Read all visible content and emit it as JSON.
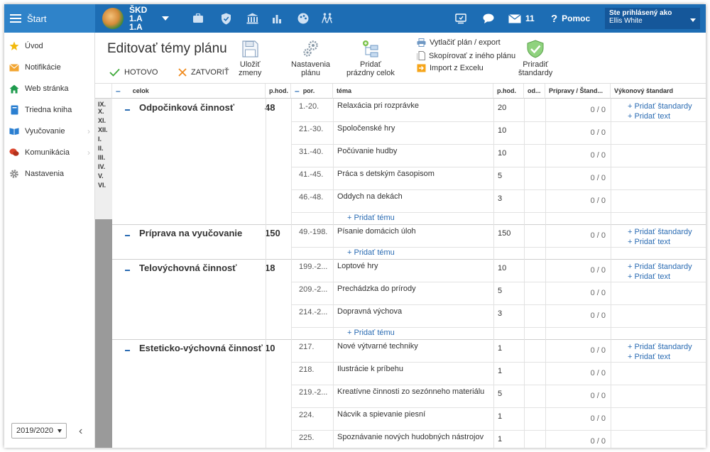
{
  "topbar": {
    "start_label": "Štart",
    "class_name": "ŠKD 1.A 1.A",
    "messages_count": "11",
    "help_label": "Pomoc",
    "user_label": "Ste prihlásený ako",
    "user_name": "Ellis White"
  },
  "sidebar": {
    "items": [
      {
        "label": "Úvod",
        "icon": "star-icon",
        "color": "#f2b90d"
      },
      {
        "label": "Notifikácie",
        "icon": "envelope-icon",
        "color": "#f2a531"
      },
      {
        "label": "Web stránka",
        "icon": "home-icon",
        "color": "#1f9b4e"
      },
      {
        "label": "Triedna kniha",
        "icon": "book-icon",
        "color": "#2b7fd1"
      },
      {
        "label": "Vyučovanie",
        "icon": "open-book-icon",
        "color": "#2b7fd1"
      },
      {
        "label": "Komunikácia",
        "icon": "chat-icon",
        "color": "#d9432a"
      },
      {
        "label": "Nastavenia",
        "icon": "gear-icon",
        "color": "#888888"
      }
    ],
    "year": "2019/2020"
  },
  "toolbar": {
    "title": "Editovať témy plánu",
    "done_label": "HOTOVO",
    "close_label": "ZATVORIŤ",
    "save_label_1": "Uložiť",
    "save_label_2": "zmeny",
    "settings_label_1": "Nastavenia",
    "settings_label_2": "plánu",
    "add_empty_label_1": "Pridať",
    "add_empty_label_2": "prázdny celok",
    "print_label": "Vytlačiť plán / export",
    "copy_label": "Skopírovať z iného plánu",
    "import_label": "Import z Excelu",
    "assign_label_1": "Priradiť",
    "assign_label_2": "štandardy"
  },
  "table": {
    "headers": {
      "celok": "celok",
      "phod": "p.hod.",
      "por": "por.",
      "tema": "téma",
      "phod2": "p.hod.",
      "od": "od...",
      "pripravy": "Prípravy / Štand...",
      "standard": "Výkonový štandard"
    },
    "months": [
      "IX.",
      "X.",
      "XI.",
      "XII.",
      "I.",
      "II.",
      "III.",
      "IV.",
      "V.",
      "VI."
    ],
    "add_topic_label": "+ Pridať tému",
    "add_standard_label": "+ Pridať štandardy",
    "add_text_label": "+ Pridať text",
    "groups": [
      {
        "title": "Odpočinková činnosť",
        "hours": "48",
        "topics": [
          {
            "por": "1.-20.",
            "tema": "Relaxácia pri rozprávke",
            "phod": "20",
            "ratio": "0 / 0"
          },
          {
            "por": "21.-30.",
            "tema": "Spoločenské hry",
            "phod": "10",
            "ratio": "0 / 0"
          },
          {
            "por": "31.-40.",
            "tema": "Počúvanie hudby",
            "phod": "10",
            "ratio": "0 / 0"
          },
          {
            "por": "41.-45.",
            "tema": "Práca s detským časopisom",
            "phod": "5",
            "ratio": "0 / 0"
          },
          {
            "por": "46.-48.",
            "tema": "Oddych na dekách",
            "phod": "3",
            "ratio": "0 / 0"
          }
        ]
      },
      {
        "title": "Príprava na vyučovanie",
        "hours": "150",
        "topics": [
          {
            "por": "49.-198.",
            "tema": "Písanie domácich úloh",
            "phod": "150",
            "ratio": "0 / 0"
          }
        ]
      },
      {
        "title": "Telovýchovná činnosť",
        "hours": "18",
        "topics": [
          {
            "por": "199.-2...",
            "tema": "Loptové hry",
            "phod": "10",
            "ratio": "0 / 0"
          },
          {
            "por": "209.-2...",
            "tema": "Prechádzka do prírody",
            "phod": "5",
            "ratio": "0 / 0"
          },
          {
            "por": "214.-2...",
            "tema": "Dopravná výchova",
            "phod": "3",
            "ratio": "0 / 0"
          }
        ]
      },
      {
        "title": "Esteticko-výchovná činnosť",
        "hours": "10",
        "topics": [
          {
            "por": "217.",
            "tema": "Nové výtvarné techniky",
            "phod": "1",
            "ratio": "0 / 0"
          },
          {
            "por": "218.",
            "tema": "Ilustrácie k príbehu",
            "phod": "1",
            "ratio": "0 / 0"
          },
          {
            "por": "219.-2...",
            "tema": "Kreatívne činnosti zo sezónneho materiálu",
            "phod": "5",
            "ratio": "0 / 0"
          },
          {
            "por": "224.",
            "tema": "Nácvik a spievanie piesní",
            "phod": "1",
            "ratio": "0 / 0"
          },
          {
            "por": "225.",
            "tema": "Spoznávanie nových hudobných nástrojov",
            "phod": "1",
            "ratio": "0 / 0"
          }
        ]
      }
    ]
  }
}
